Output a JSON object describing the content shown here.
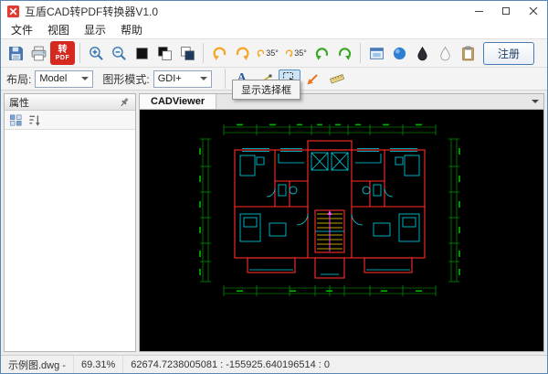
{
  "window": {
    "title": "互盾CAD转PDF转换器V1.0"
  },
  "menubar": {
    "items": [
      {
        "label": "文件"
      },
      {
        "label": "视图"
      },
      {
        "label": "显示"
      },
      {
        "label": "帮助"
      }
    ]
  },
  "toolbar": {
    "pdf_button_line1": "转",
    "pdf_button_line2": "PDF",
    "rotate_ccw_label": "35°",
    "rotate_cw_label": "35°",
    "register_label": "注册"
  },
  "toolbar2": {
    "layout_label": "布局:",
    "layout_value": "Model",
    "mode_label": "图形模式:",
    "mode_value": "GDI+",
    "font_button_label": "A"
  },
  "sidebar": {
    "title": "属性"
  },
  "main": {
    "tab_label": "CADViewer",
    "tooltip": "显示选择框"
  },
  "statusbar": {
    "filename": "示例图.dwg -",
    "zoom": "69.31%",
    "coordinates": "62674.7238005081 : -155925.640196514 : 0"
  },
  "colors": {
    "accent_red": "#d5281e",
    "register_border_blue": "#4a7ab5",
    "viewport_bg": "#000000",
    "cad_wall_red": "#ff2d2d",
    "cad_detail_cyan": "#00d8e8",
    "cad_dim_green": "#00b400",
    "cad_stair_yellow": "#ffd400"
  }
}
